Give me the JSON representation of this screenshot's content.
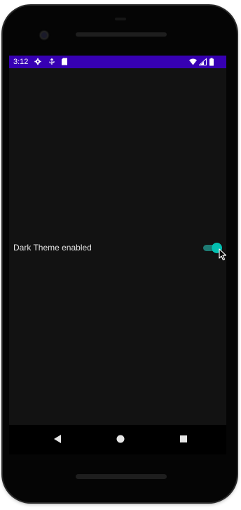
{
  "status_bar": {
    "time": "3:12",
    "background_color": "#3700b3",
    "left_icons": [
      "gear-icon",
      "usb-debug-icon",
      "sd-card-icon"
    ],
    "right_icons": [
      "wifi-icon",
      "cell-signal-icon",
      "battery-icon"
    ]
  },
  "screen": {
    "background_color": "#121212"
  },
  "setting": {
    "label": "Dark Theme enabled",
    "switch_on": true,
    "accent_color": "#03bfb0"
  },
  "nav_bar": {
    "buttons": [
      "back-icon",
      "home-icon",
      "overview-icon"
    ]
  }
}
